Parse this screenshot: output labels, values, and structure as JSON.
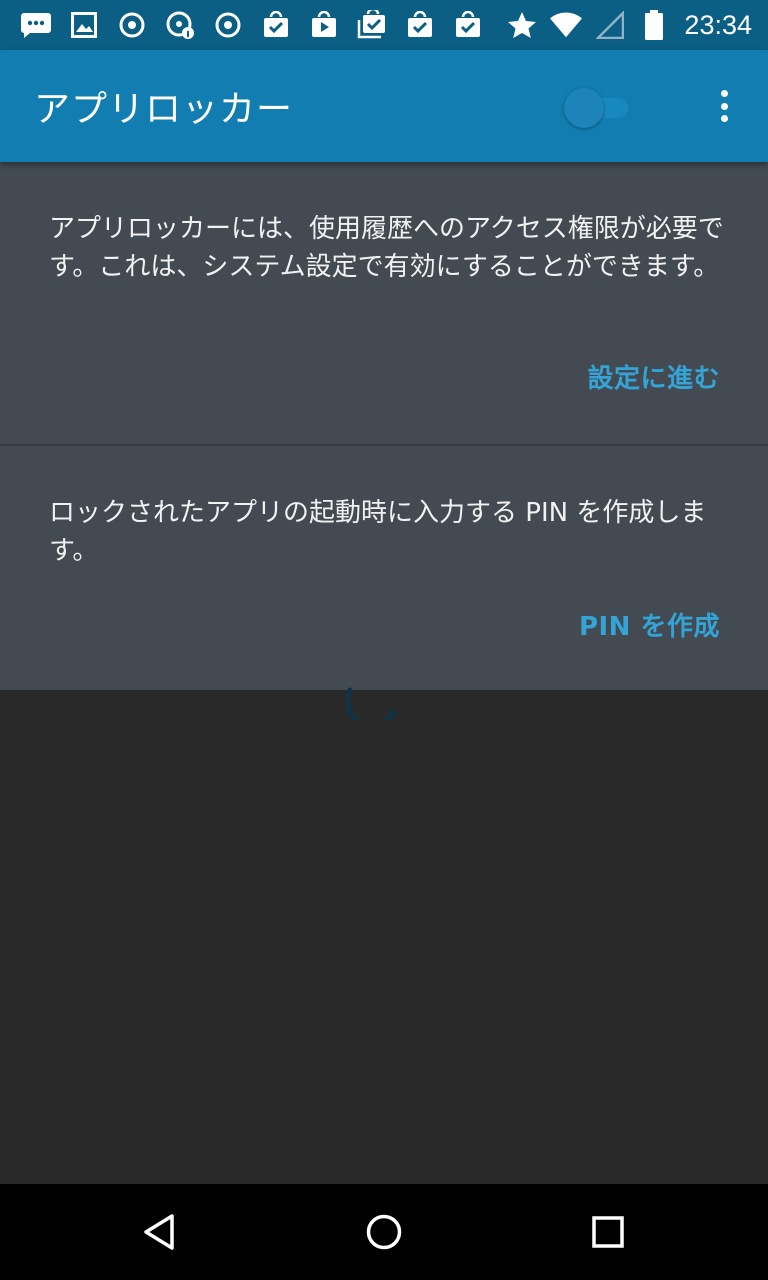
{
  "status_bar": {
    "time": "23:34",
    "left_icons": [
      "sms-icon",
      "image-icon",
      "sync-icon",
      "info-icon",
      "sync-icon",
      "shopping-bag-check-icon",
      "play-store-icon",
      "multi-check-icon",
      "shopping-bag-check-icon",
      "shopping-bag-check-icon"
    ],
    "right_icons": [
      "star-icon",
      "wifi-icon",
      "signal-icon",
      "battery-icon"
    ]
  },
  "app_bar": {
    "title": "アプリロッカー",
    "toggle_on": false
  },
  "cards": [
    {
      "text": "アプリロッカーには、使用履歴へのアクセス権限が必要です。これは、システム設定で有効にすることができます。",
      "action": "設定に進む"
    },
    {
      "text": "ロックされたアプリの起動時に入力する PIN を作成します。",
      "action": "PIN を作成"
    }
  ],
  "colors": {
    "status_bar": "#0b5f85",
    "app_bar": "#127db0",
    "card": "#434a52",
    "accent": "#34a3d6",
    "background": "#292929"
  }
}
